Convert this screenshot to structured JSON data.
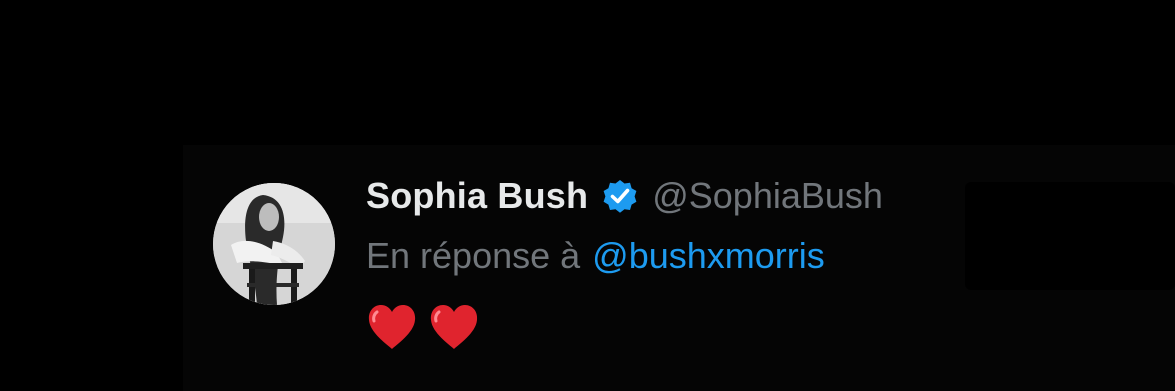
{
  "tweet": {
    "author": {
      "display_name": "Sophia Bush",
      "handle": "@SophiaBush",
      "verified": true,
      "avatar_icon": "profile-photo-bw"
    },
    "reply": {
      "prefix": "En réponse à",
      "mention": "@bushxmorris"
    },
    "content": {
      "emojis": [
        "❤️",
        "❤️"
      ],
      "icon": "red-heart-icon"
    }
  },
  "colors": {
    "background": "#000000",
    "name": "#e7e9ea",
    "secondary_text": "#71767b",
    "link": "#1d9bf0",
    "verified_badge": "#1d9bf0",
    "heart": "#e0242e"
  }
}
